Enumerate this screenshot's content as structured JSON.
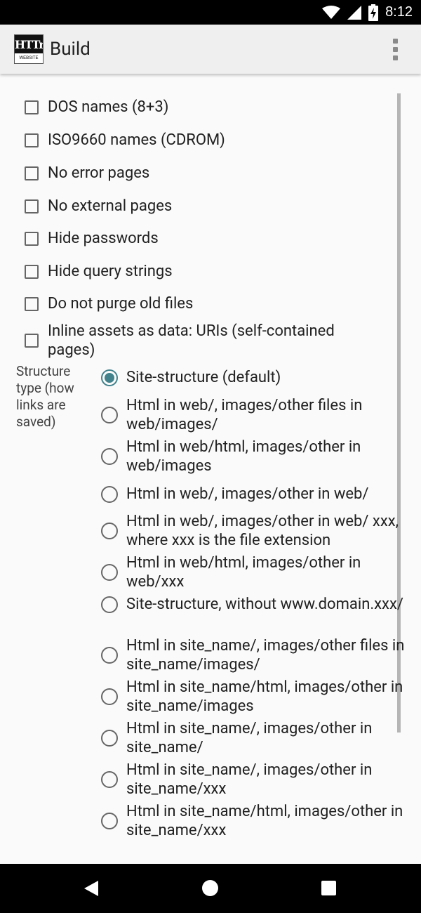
{
  "status_bar": {
    "time": "8:12"
  },
  "app_bar": {
    "logo": {
      "top_text": "HTTrack",
      "bottom_text": "WEBSITE COPIER"
    },
    "title": "Build"
  },
  "options": [
    {
      "label": "DOS names (8+3)",
      "checked": false
    },
    {
      "label": "ISO9660 names (CDROM)",
      "checked": false
    },
    {
      "label": "No error pages",
      "checked": false
    },
    {
      "label": "No external pages",
      "checked": false
    },
    {
      "label": "Hide passwords",
      "checked": false
    },
    {
      "label": "Hide query strings",
      "checked": false
    },
    {
      "label": "Do not purge old files",
      "checked": false
    },
    {
      "label": "Inline assets as data: URIs (self-contained pages)",
      "checked": false
    }
  ],
  "structure": {
    "label": "Structure type (how links are saved)",
    "choices": [
      {
        "label": "Site-structure (default)",
        "selected": true
      },
      {
        "label": "Html in web/, images/other files in web/images/",
        "selected": false
      },
      {
        "label": "Html in web/html, images/other in web/images",
        "selected": false
      },
      {
        "label": "Html in web/, images/other in web/",
        "selected": false
      },
      {
        "label": "Html in web/, images/other in web/ xxx, where xxx is the file extension",
        "selected": false
      },
      {
        "label": "Html in web/html, images/other in web/xxx",
        "selected": false
      },
      {
        "label": "Site-structure, without www.domain.xxx/",
        "selected": false
      },
      {
        "label": "Html in site_name/, images/other files in site_name/images/",
        "selected": false
      },
      {
        "label": "Html in site_name/html, images/other in site_name/images",
        "selected": false
      },
      {
        "label": "Html in site_name/, images/other in site_name/",
        "selected": false
      },
      {
        "label": "Html in site_name/, images/other in site_name/xxx",
        "selected": false
      },
      {
        "label": "Html in site_name/html, images/other in site_name/xxx",
        "selected": false
      }
    ]
  },
  "colors": {
    "accent": "#41828c",
    "app_bar": "#efefef",
    "background": "#fafafa"
  }
}
